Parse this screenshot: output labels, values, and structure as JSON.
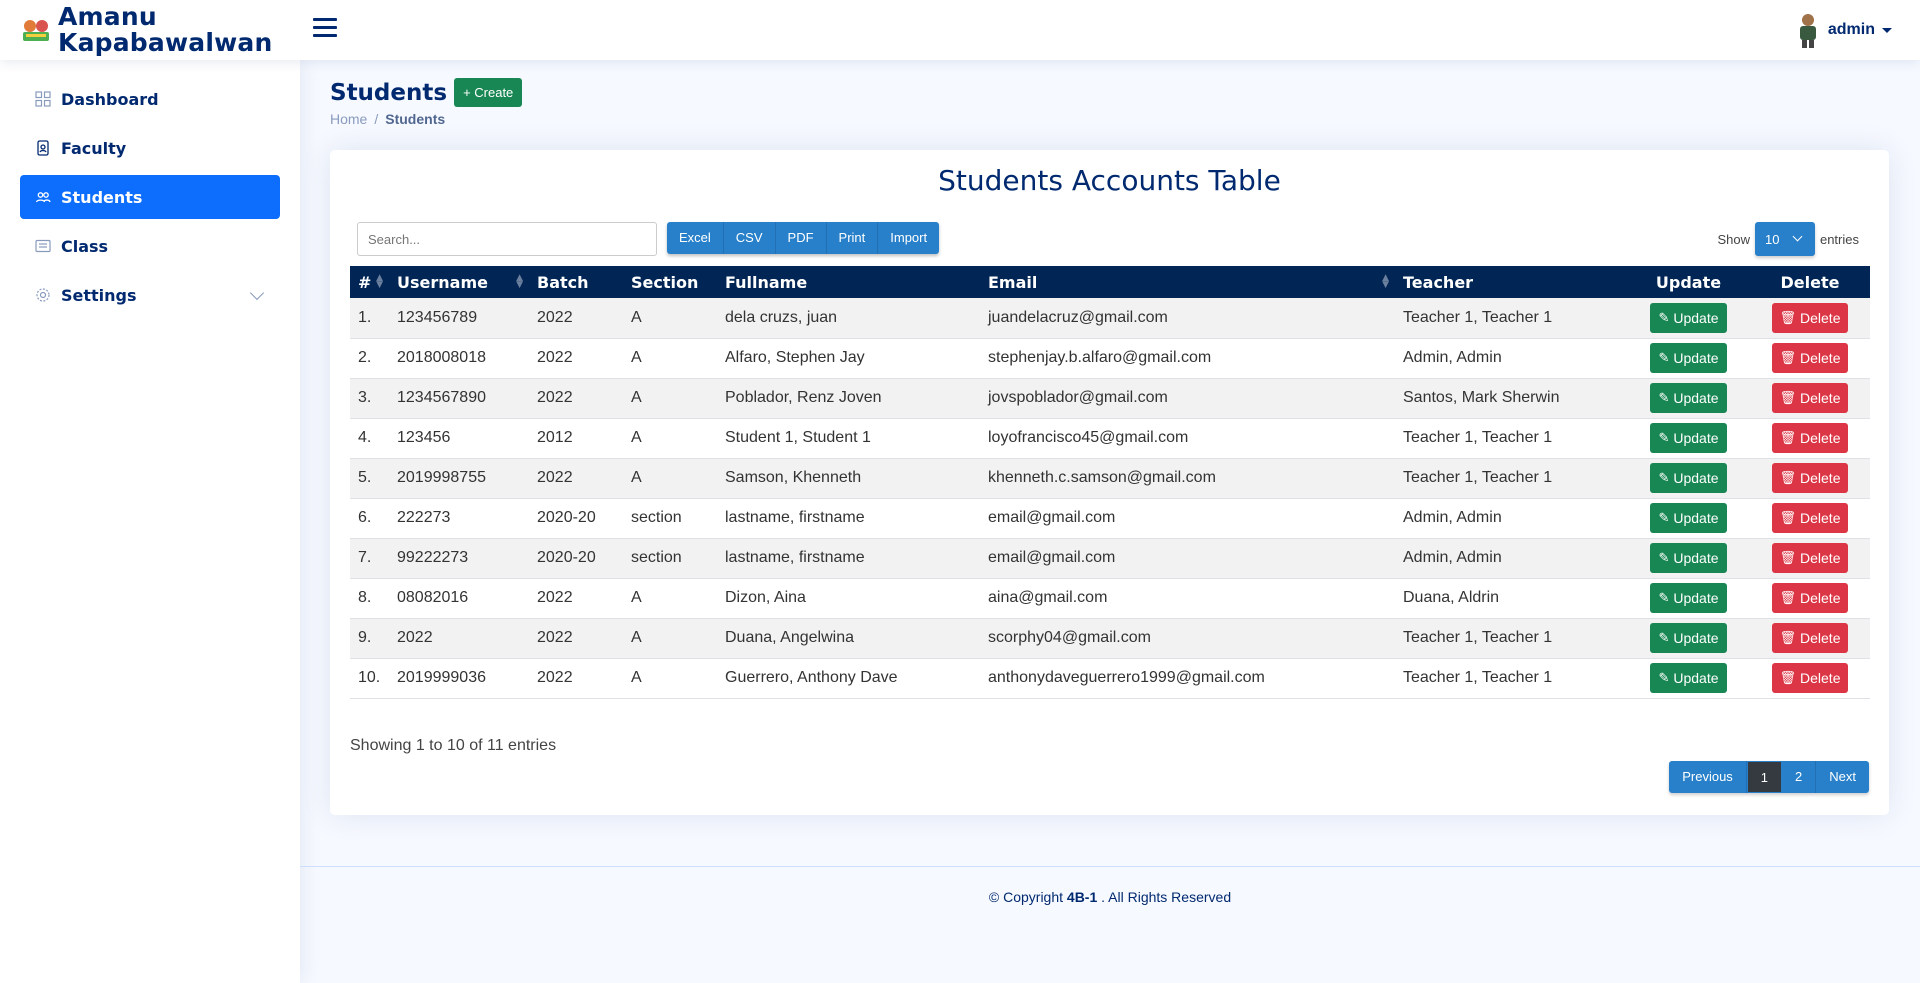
{
  "app": {
    "title_line1": "Amanu",
    "title_line2": "Kapabawalwan"
  },
  "header": {
    "user_name": "admin"
  },
  "sidebar": {
    "items": [
      {
        "label": "Dashboard",
        "icon": "grid-icon"
      },
      {
        "label": "Faculty",
        "icon": "person-badge-icon"
      },
      {
        "label": "Students",
        "icon": "people-icon",
        "active": true
      },
      {
        "label": "Class",
        "icon": "card-list-icon"
      },
      {
        "label": "Settings",
        "icon": "gear-icon"
      }
    ]
  },
  "page": {
    "title": "Students",
    "create_label": "+ Create",
    "breadcrumb": {
      "home": "Home",
      "separator": "/",
      "current": "Students"
    }
  },
  "table_section": {
    "title": "Students Accounts Table",
    "search_placeholder": "Search...",
    "export_buttons": [
      "Excel",
      "CSV",
      "PDF",
      "Print",
      "Import"
    ],
    "show_label": "Show",
    "show_value": "10",
    "entries_label": "entries",
    "columns": [
      "#",
      "Username",
      "Batch",
      "Section",
      "Fullname",
      "Email",
      "Teacher",
      "Update",
      "Delete"
    ],
    "update_label": "Update",
    "delete_label": "Delete",
    "rows": [
      [
        "1.",
        "123456789",
        "2022",
        "A",
        "dela cruzs, juan",
        "juandelacruz@gmail.com",
        "Teacher 1, Teacher 1"
      ],
      [
        "2.",
        "2018008018",
        "2022",
        "A",
        "Alfaro, Stephen Jay",
        "stephenjay.b.alfaro@gmail.com",
        "Admin, Admin"
      ],
      [
        "3.",
        "1234567890",
        "2022",
        "A",
        "Poblador, Renz Joven",
        "jovspoblador@gmail.com",
        "Santos, Mark Sherwin"
      ],
      [
        "4.",
        "123456",
        "2012",
        "A",
        "Student 1, Student 1",
        "loyofrancisco45@gmail.com",
        "Teacher 1, Teacher 1"
      ],
      [
        "5.",
        "2019998755",
        "2022",
        "A",
        "Samson, Khenneth",
        "khenneth.c.samson@gmail.com",
        "Teacher 1, Teacher 1"
      ],
      [
        "6.",
        "222273",
        "2020-20",
        "section",
        "lastname, firstname",
        "email@gmail.com",
        "Admin, Admin"
      ],
      [
        "7.",
        "99222273",
        "2020-20",
        "section",
        "lastname, firstname",
        "email@gmail.com",
        "Admin, Admin"
      ],
      [
        "8.",
        "08082016",
        "2022",
        "A",
        "Dizon, Aina",
        "aina@gmail.com",
        "Duana, Aldrin"
      ],
      [
        "9.",
        "2022",
        "2022",
        "A",
        "Duana, Angelwina",
        "scorphy04@gmail.com",
        "Teacher 1, Teacher 1"
      ],
      [
        "10.",
        "2019999036",
        "2022",
        "A",
        "Guerrero, Anthony Dave",
        "anthonydaveguerrero1999@gmail.com",
        "Teacher 1, Teacher 1"
      ]
    ],
    "info": "Showing 1 to 10 of 11 entries",
    "pagination": [
      "Previous",
      "1",
      "2",
      "Next"
    ],
    "active_page": "1"
  },
  "footer": {
    "prefix": "© Copyright ",
    "brand": "4B-1",
    "suffix": " . All Rights Reserved"
  },
  "colors": {
    "primary": "#0d6efd",
    "navy": "#012970",
    "table_head": "#012554",
    "success": "#198754",
    "danger": "#dc3545",
    "button_blue": "#2780c9"
  }
}
